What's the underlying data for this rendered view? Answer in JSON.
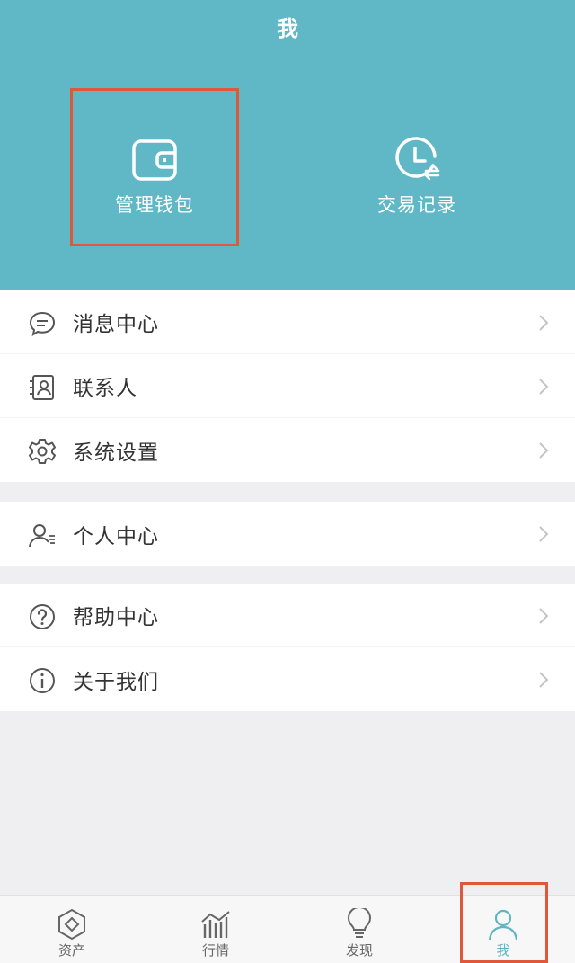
{
  "header": {
    "title": "我"
  },
  "quick_actions": [
    {
      "label": "管理钱包",
      "icon": "wallet-icon"
    },
    {
      "label": "交易记录",
      "icon": "clock-history-icon"
    }
  ],
  "menu_groups": [
    [
      {
        "label": "消息中心",
        "icon": "message-icon"
      },
      {
        "label": "联系人",
        "icon": "contacts-icon"
      },
      {
        "label": "系统设置",
        "icon": "gear-icon"
      }
    ],
    [
      {
        "label": "个人中心",
        "icon": "user-list-icon"
      }
    ],
    [
      {
        "label": "帮助中心",
        "icon": "question-icon"
      },
      {
        "label": "关于我们",
        "icon": "info-icon"
      }
    ]
  ],
  "tabs": [
    {
      "label": "资产",
      "icon": "asset-diamond-icon",
      "active": false
    },
    {
      "label": "行情",
      "icon": "market-chart-icon",
      "active": false
    },
    {
      "label": "发现",
      "icon": "lightbulb-icon",
      "active": false
    },
    {
      "label": "我",
      "icon": "person-icon",
      "active": true
    }
  ],
  "colors": {
    "header_bg": "#60b7c5",
    "accent": "#5fb5c2",
    "highlight_box": "#e0583a",
    "page_bg": "#efeff1"
  }
}
